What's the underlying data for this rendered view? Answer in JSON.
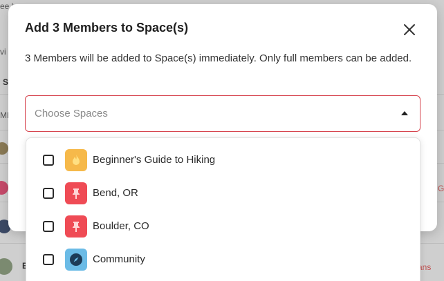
{
  "background": {
    "partial_texts": [
      "ee h",
      "vi",
      "S",
      "ME",
      "G",
      "ans",
      "E"
    ]
  },
  "modal": {
    "title": "Add 3 Members to Space(s)",
    "description": "3 Members will be added to Space(s) immediately. Only full members can be added.",
    "select": {
      "placeholder": "Choose Spaces"
    },
    "options": [
      {
        "label": "Beginner's Guide to Hiking",
        "icon": "flame-icon",
        "icon_bg": "#f6b94a",
        "checked": false
      },
      {
        "label": "Bend, OR",
        "icon": "pin-icon",
        "icon_bg": "#ef4b55",
        "checked": false
      },
      {
        "label": "Boulder, CO",
        "icon": "pin-icon",
        "icon_bg": "#ef4b55",
        "checked": false
      },
      {
        "label": "Community",
        "icon": "compass-icon",
        "icon_bg": "#6bbbe6",
        "checked": false
      }
    ]
  },
  "colors": {
    "select_border": "#d6434d",
    "accent_red": "#ef4b55"
  }
}
